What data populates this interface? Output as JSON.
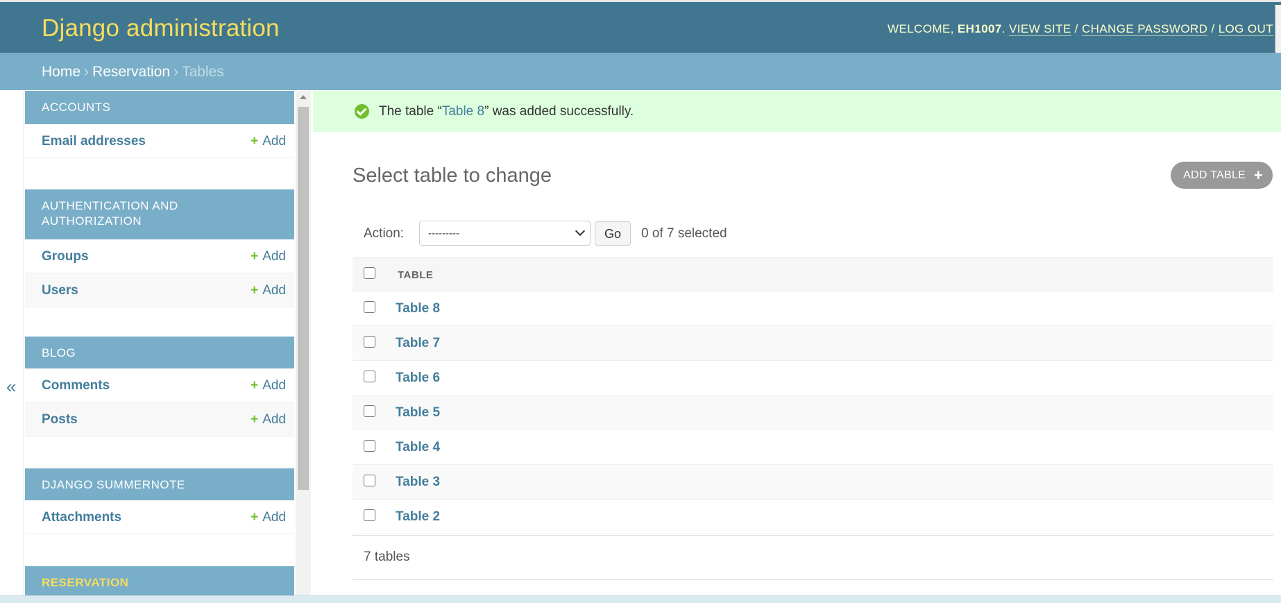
{
  "header": {
    "brand": "Django administration",
    "welcome": "WELCOME,",
    "username": "EH1007",
    "view_site": "VIEW SITE",
    "change_password": "CHANGE PASSWORD",
    "log_out": "LOG OUT"
  },
  "breadcrumbs": {
    "home": "Home",
    "app": "Reservation",
    "current": "Tables",
    "separator": "›"
  },
  "sidebar": {
    "toggle": "«",
    "add_label": "Add",
    "add_plus": "+",
    "modules": [
      {
        "caption": "ACCOUNTS",
        "models": [
          "Email addresses"
        ]
      },
      {
        "caption": "AUTHENTICATION AND AUTHORIZATION",
        "models": [
          "Groups",
          "Users"
        ]
      },
      {
        "caption": "BLOG",
        "models": [
          "Comments",
          "Posts"
        ]
      },
      {
        "caption": "DJANGO SUMMERNOTE",
        "models": [
          "Attachments"
        ]
      },
      {
        "caption": "RESERVATION",
        "models": []
      }
    ]
  },
  "message": {
    "prefix": "The table “",
    "link": "Table 8",
    "suffix": "” was added successfully."
  },
  "content": {
    "title": "Select table to change",
    "add_button": "ADD TABLE",
    "add_plus": "+",
    "action_label": "Action:",
    "action_value": "---------",
    "go_button": "Go",
    "selected_count": "0 of 7 selected",
    "column_header": "TABLE",
    "rows": [
      "Table 8",
      "Table 7",
      "Table 6",
      "Table 5",
      "Table 4",
      "Table 3",
      "Table 2"
    ],
    "paginator": "7 tables"
  },
  "colors": {
    "header_bg": "#417690",
    "brand": "#f5dd5d",
    "breadcrumb_bg": "#79aec8",
    "link": "#447e9b",
    "success_bg": "#ddffdd",
    "add_green": "#70bf2b"
  }
}
